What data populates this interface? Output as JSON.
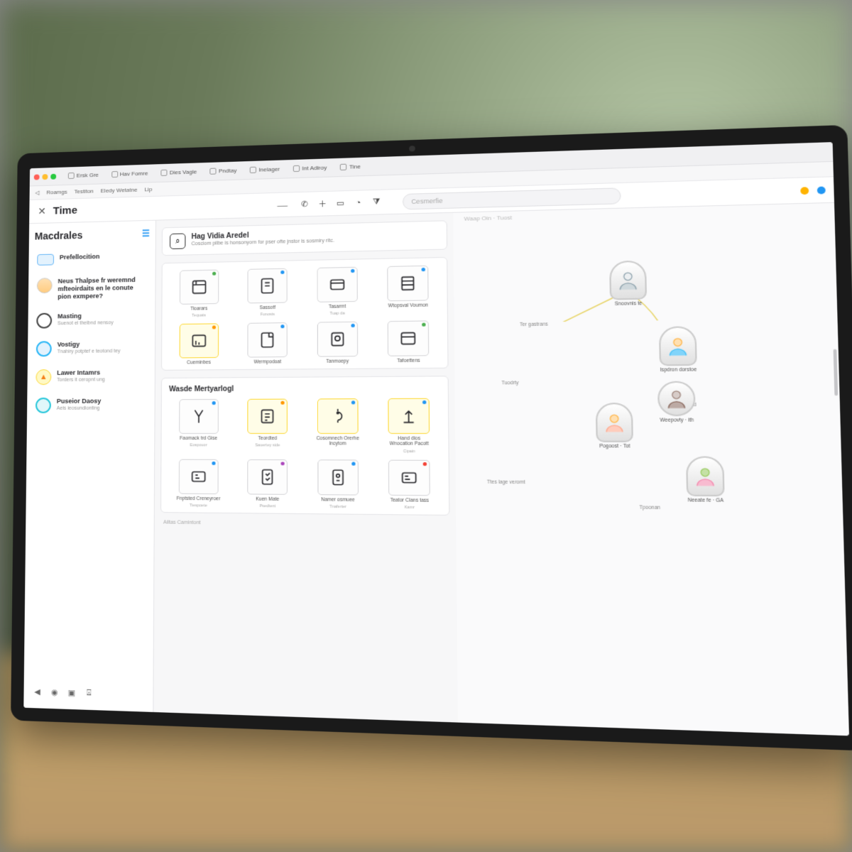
{
  "browser": {
    "tabs": [
      {
        "label": "Ersk Gre"
      },
      {
        "label": "Hav Fomre"
      },
      {
        "label": "Dies Vagle"
      },
      {
        "label": "Pndtay"
      },
      {
        "label": "Inelager"
      },
      {
        "label": "Int Adiroy"
      },
      {
        "label": "Tine"
      }
    ],
    "bookmarks": [
      {
        "label": "Roamgs"
      },
      {
        "label": "Testiton"
      },
      {
        "label": "Eledy Wetatne"
      },
      {
        "label": "Lip"
      }
    ]
  },
  "header": {
    "title": "Time",
    "search_placeholder": "Cesmerfie"
  },
  "sidebar": {
    "brand": "Macdrales",
    "items": [
      {
        "id": "pref",
        "title": "Prefellocition",
        "sub": ""
      },
      {
        "id": "user",
        "title": "Neus Thalpse fr weremnd mfteoirdaits en le conute pion exmpere?",
        "sub": ""
      },
      {
        "id": "mast",
        "title": "Masting",
        "sub": "Suenot el theibnd nensoy"
      },
      {
        "id": "vost",
        "title": "Vostigy",
        "sub": "Tnahiry potptef e teotond tey"
      },
      {
        "id": "low",
        "title": "Lawer Intamrs",
        "sub": "Torders it ceropnt ung"
      },
      {
        "id": "pus",
        "title": "Puseior Daosy",
        "sub": "Aeis ieosundionting"
      }
    ]
  },
  "center": {
    "banner": {
      "title": "Hag Vidia Aredel",
      "sub": "Cosciom pilbe is honsonyorn for pser ofte jnstor is sosmiry ritc."
    },
    "panel1": {
      "cards": [
        {
          "label": "Tioarars",
          "sub": "Tequats",
          "pin": "g"
        },
        {
          "label": "Sassotf",
          "sub": "Funosts",
          "pin": "b"
        },
        {
          "label": "Tasarmt",
          "sub": "Tuap da",
          "pin": "b"
        },
        {
          "label": "Wtopsval Voumon",
          "sub": "",
          "pin": "b"
        },
        {
          "label": "Cueminbes",
          "sub": "",
          "pin": "o",
          "ylw": true
        },
        {
          "label": "Wermpodoat",
          "sub": "",
          "pin": "b"
        },
        {
          "label": "Tanmoepy",
          "sub": "",
          "pin": "b"
        },
        {
          "label": "Tafoettens",
          "sub": "",
          "pin": "g"
        }
      ]
    },
    "panel2": {
      "title": "Wasde Mertyarlogl",
      "cards": [
        {
          "label": "Faomack trd Gise",
          "sub": "Eospouor",
          "pin": "b"
        },
        {
          "label": "Teordted",
          "sub": "Sauertey side",
          "pin": "o",
          "ylw": true
        },
        {
          "label": "Cosomnech Orerhe lncytom",
          "sub": "",
          "pin": "b",
          "ylw": true
        },
        {
          "label": "Hand dios Wnocation Pacott",
          "sub": "Cipain",
          "pin": "b",
          "ylw": true
        },
        {
          "label": "Fnptsted Creneyroer",
          "sub": "Tiespoete",
          "pin": "b"
        },
        {
          "label": "Kuen Mate",
          "sub": "Psedtent",
          "pin": "p"
        },
        {
          "label": "Namer osmuee",
          "sub": "Tnaferter",
          "pin": "b"
        },
        {
          "label": "Teator Clans tass",
          "sub": "Kamr",
          "pin": "r"
        }
      ]
    },
    "footer": "Ailtas Camintont"
  },
  "graph": {
    "crumb": "Waap Oin · Tuost",
    "labels": {
      "l1": "Ter gastrans",
      "l2": "Tuodrty",
      "l3": "Ttes lage veromt",
      "l4": "Ittati",
      "l5": "Tpoonan"
    },
    "nodes": [
      {
        "id": "n1",
        "label": "Snoovnis te"
      },
      {
        "id": "n2",
        "label": "Ispdron dorstoe"
      },
      {
        "id": "n3",
        "label": "Weepovty · ith"
      },
      {
        "id": "n4",
        "label": "Pogoost · Tot"
      },
      {
        "id": "n5",
        "label": "Neeate fe · GA"
      }
    ]
  }
}
